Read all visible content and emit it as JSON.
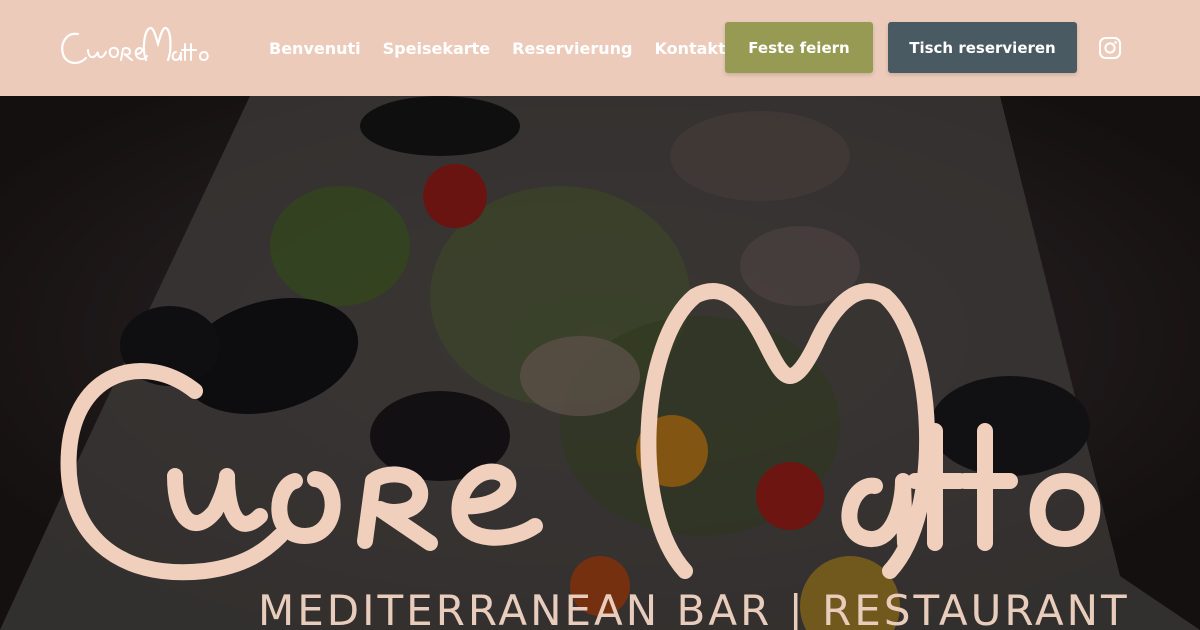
{
  "header": {
    "logo_text": "Cuore Matto",
    "nav": [
      {
        "label": "Benvenuti"
      },
      {
        "label": "Speisekarte"
      },
      {
        "label": "Reservierung"
      },
      {
        "label": "Kontakt"
      }
    ],
    "party_button": "Feste feiern",
    "reserve_button": "Tisch reservieren",
    "social_icon": "instagram-icon"
  },
  "hero": {
    "logo_text": "Cuore Matto",
    "subtitle": "MEDITERRANEAN BAR | RESTAURANT",
    "background": "salad-with-mussels-photo"
  },
  "colors": {
    "header_bg": "#eccbba",
    "party_button_bg": "#979a52",
    "reserve_button_bg": "#4a5a62",
    "logo_color": "#f0cfbd",
    "nav_text": "#ffffff"
  }
}
